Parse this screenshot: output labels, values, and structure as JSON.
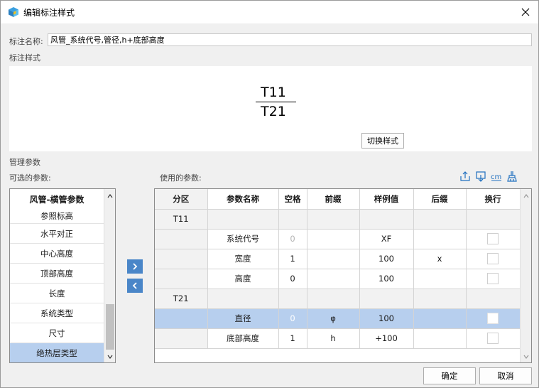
{
  "window": {
    "title": "编辑标注样式"
  },
  "annotation_name": {
    "label": "标注名称:",
    "value": "风管_系统代号,管径,h+底部高度"
  },
  "style_section": {
    "label": "标注样式",
    "preview_top": "T11",
    "preview_bottom": "T21",
    "switch_button": "切换样式"
  },
  "params_section": {
    "label": "管理参数",
    "available_label": "可选的参数:",
    "used_label": "使用的参数:",
    "toolbar_icons": [
      "export-icon",
      "import-icon",
      "unit-cm-icon",
      "clear-icon"
    ]
  },
  "available": {
    "header": "风管-横管参数",
    "items": [
      "参照标高",
      "水平对正",
      "中心高度",
      "顶部高度",
      "长度",
      "系统类型",
      "尺寸",
      "绝热层类型"
    ],
    "selected_index": 7
  },
  "move_buttons": {
    "add": ">",
    "remove": "<"
  },
  "used_table": {
    "columns": [
      "分区",
      "参数名称",
      "空格",
      "前缀",
      "样例值",
      "后缀",
      "换行"
    ],
    "rows": [
      {
        "zone": "T11",
        "name": "",
        "space": "",
        "prefix": "",
        "sample": "",
        "suffix": "",
        "wrap": null,
        "group": true
      },
      {
        "zone": "",
        "name": "系统代号",
        "space": "0",
        "prefix": "",
        "sample": "XF",
        "suffix": "",
        "wrap": false,
        "space_disabled": true
      },
      {
        "zone": "",
        "name": "宽度",
        "space": "1",
        "prefix": "",
        "sample": "100",
        "suffix": "x",
        "wrap": false
      },
      {
        "zone": "",
        "name": "高度",
        "space": "0",
        "prefix": "",
        "sample": "100",
        "suffix": "",
        "wrap": false
      },
      {
        "zone": "T21",
        "name": "",
        "space": "",
        "prefix": "",
        "sample": "",
        "suffix": "",
        "wrap": null,
        "group": true
      },
      {
        "zone": "",
        "name": "直径",
        "space": "0",
        "prefix": "φ",
        "sample": "100",
        "suffix": "",
        "wrap": false,
        "selected": true,
        "space_disabled": true
      },
      {
        "zone": "",
        "name": "底部高度",
        "space": "1",
        "prefix": "h",
        "sample": "+100",
        "suffix": "",
        "wrap": false
      }
    ]
  },
  "footer": {
    "ok": "确定",
    "cancel": "取消"
  },
  "colors": {
    "selection": "#b7cfee",
    "move_button": "#4a86c8",
    "toolbar_icon": "#1f6fbf"
  }
}
